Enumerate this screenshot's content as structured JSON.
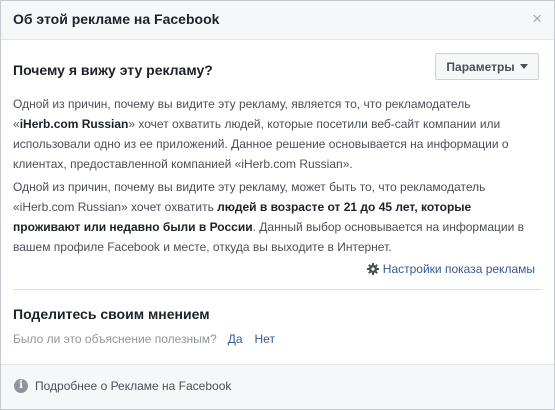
{
  "header": {
    "title": "Об этой рекламе на Facebook",
    "close_symbol": "×"
  },
  "why": {
    "heading": "Почему я вижу эту рекламу?",
    "params_button": "Параметры",
    "para1": {
      "t1": "Одной из причин, почему вы видите эту рекламу, является то, что рекламодатель «",
      "b1": "iHerb.com Russian",
      "t2": "» хочет охватить людей, которые посетили веб-сайт компании или использовали одно из ее приложений. Данное решение основывается на информации о клиентах, предоставленной компанией «iHerb.com Russian»."
    },
    "para2": {
      "t1": "Одной из причин, почему вы видите эту рекламу, может быть то, что рекламодатель «iHerb.com Russian» хочет охватить ",
      "b1": "людей в возрасте от 21 до 45 лет, которые проживают или недавно были в России",
      "t2": ". Данный выбор основывается на информации в вашем профиле Facebook и месте, откуда вы выходите в Интернет."
    },
    "settings_link": "Настройки показа рекламы"
  },
  "feedback": {
    "heading": "Поделитесь своим мнением",
    "question": "Было ли это объяснение полезным?",
    "yes": "Да",
    "no": "Нет"
  },
  "footer": {
    "info_symbol": "i",
    "link": "Подробнее о Рекламе на Facebook"
  },
  "colors": {
    "link": "#365899",
    "header_bg": "#f6f7f9",
    "muted": "#90949c"
  }
}
